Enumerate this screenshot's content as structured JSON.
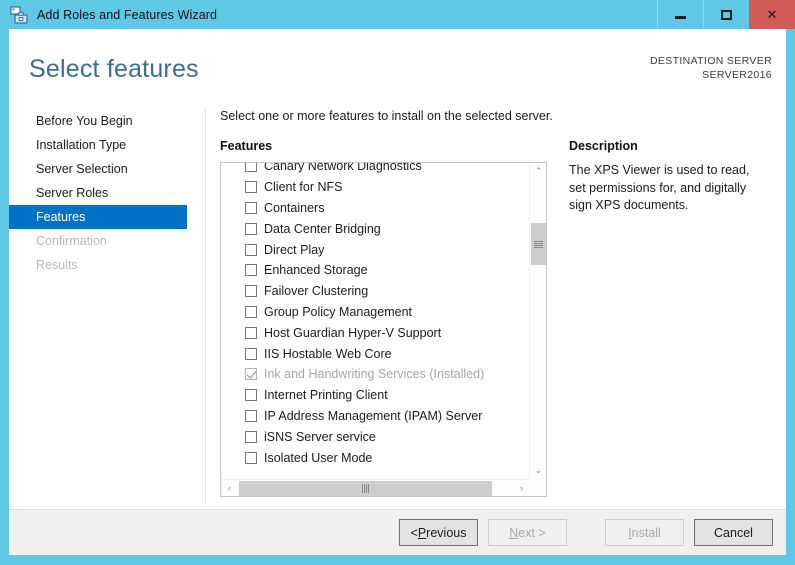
{
  "window": {
    "title": "Add Roles and Features Wizard",
    "icon": "server-wizard-icon",
    "minimize_label": "–",
    "maximize_label": "□",
    "close_label": "✕",
    "titlebar_color": "#5ec8e5",
    "close_button_color": "#d35b56"
  },
  "header": {
    "page_title": "Select features",
    "destination_label": "DESTINATION SERVER",
    "destination_server": "SERVER2016"
  },
  "sidebar": {
    "items": [
      {
        "label": "Before You Begin",
        "state": "normal"
      },
      {
        "label": "Installation Type",
        "state": "normal"
      },
      {
        "label": "Server Selection",
        "state": "normal"
      },
      {
        "label": "Server Roles",
        "state": "normal"
      },
      {
        "label": "Features",
        "state": "selected"
      },
      {
        "label": "Confirmation",
        "state": "disabled"
      },
      {
        "label": "Results",
        "state": "disabled"
      }
    ],
    "selected_color": "#0072c6"
  },
  "main": {
    "instruction": "Select one or more features to install on the selected server.",
    "features_label": "Features",
    "features": [
      {
        "label": "Canary Network Diagnostics",
        "checked": false,
        "disabled": false
      },
      {
        "label": "Client for NFS",
        "checked": false,
        "disabled": false
      },
      {
        "label": "Containers",
        "checked": false,
        "disabled": false
      },
      {
        "label": "Data Center Bridging",
        "checked": false,
        "disabled": false
      },
      {
        "label": "Direct Play",
        "checked": false,
        "disabled": false
      },
      {
        "label": "Enhanced Storage",
        "checked": false,
        "disabled": false
      },
      {
        "label": "Failover Clustering",
        "checked": false,
        "disabled": false
      },
      {
        "label": "Group Policy Management",
        "checked": false,
        "disabled": false
      },
      {
        "label": "Host Guardian Hyper-V Support",
        "checked": false,
        "disabled": false
      },
      {
        "label": "IIS Hostable Web Core",
        "checked": false,
        "disabled": false
      },
      {
        "label": "Ink and Handwriting Services (Installed)",
        "checked": true,
        "disabled": true
      },
      {
        "label": "Internet Printing Client",
        "checked": false,
        "disabled": false
      },
      {
        "label": "IP Address Management (IPAM) Server",
        "checked": false,
        "disabled": false
      },
      {
        "label": "iSNS Server service",
        "checked": false,
        "disabled": false
      },
      {
        "label": "Isolated User Mode",
        "checked": false,
        "disabled": false
      }
    ],
    "scrollbar": {
      "up_arrow": "⌃",
      "down_arrow": "⌄",
      "left_arrow": "‹",
      "right_arrow": "›"
    }
  },
  "description": {
    "title": "Description",
    "body": "The XPS Viewer is used to read, set permissions for, and digitally sign XPS documents."
  },
  "footer": {
    "previous": {
      "prefix": "< ",
      "accel": "P",
      "rest": "revious",
      "enabled": true
    },
    "next": {
      "prefix": "",
      "accel": "N",
      "rest": "ext >",
      "enabled": false
    },
    "install": {
      "prefix": "",
      "accel": "I",
      "rest": "nstall",
      "enabled": false
    },
    "cancel": {
      "prefix": "",
      "accel": "",
      "rest": "Cancel",
      "enabled": true
    }
  }
}
